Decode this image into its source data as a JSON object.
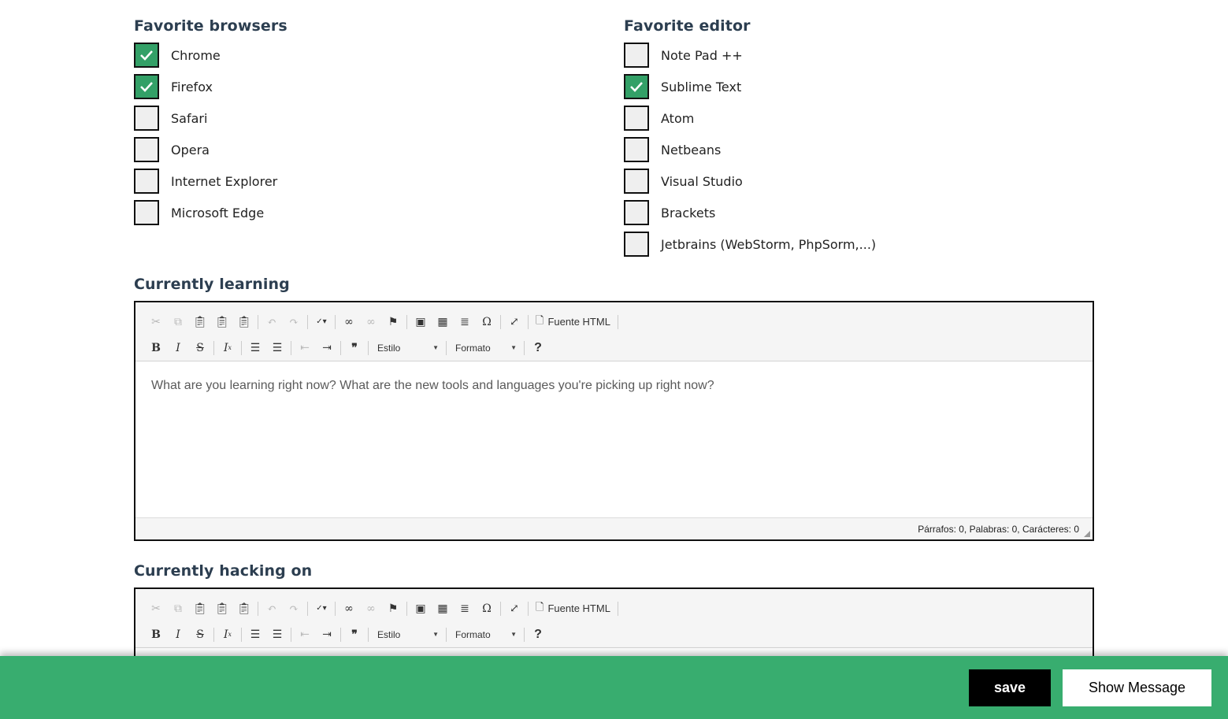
{
  "browsers": {
    "title": "Favorite browsers",
    "items": [
      {
        "label": "Chrome",
        "checked": true
      },
      {
        "label": "Firefox",
        "checked": true
      },
      {
        "label": "Safari",
        "checked": false
      },
      {
        "label": "Opera",
        "checked": false
      },
      {
        "label": "Internet Explorer",
        "checked": false
      },
      {
        "label": "Microsoft Edge",
        "checked": false
      }
    ]
  },
  "editors": {
    "title": "Favorite editor",
    "items": [
      {
        "label": "Note Pad ++",
        "checked": false
      },
      {
        "label": "Sublime Text",
        "checked": true
      },
      {
        "label": "Atom",
        "checked": false
      },
      {
        "label": "Netbeans",
        "checked": false
      },
      {
        "label": "Visual Studio",
        "checked": false
      },
      {
        "label": "Brackets",
        "checked": false
      },
      {
        "label": "Jetbrains (WebStorm, PhpSorm,...)",
        "checked": false
      }
    ]
  },
  "learning": {
    "title": "Currently learning",
    "placeholder": "What are you learning right now? What are the new tools and languages you're picking up right now?",
    "status": "Párrafos: 0, Palabras: 0, Carácteres: 0"
  },
  "hacking": {
    "title": "Currently hacking on"
  },
  "toolbar": {
    "source_label": "Fuente HTML",
    "style_label": "Estilo",
    "format_label": "Formato",
    "help_label": "?",
    "bold_label": "B",
    "italic_label": "I",
    "strike_label": "S",
    "omega_label": "Ω",
    "quote_label": "❞"
  },
  "footer": {
    "save_label": "save",
    "show_label": "Show Message"
  },
  "colors": {
    "accent": "#38ad6f",
    "checked": "#33a067",
    "title": "#2c3e50"
  }
}
